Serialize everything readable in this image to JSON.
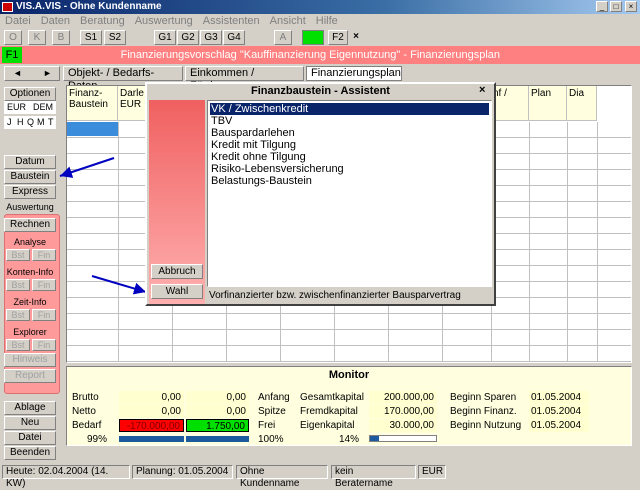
{
  "window": {
    "title": "VIS.A.VIS - Ohne Kundenname"
  },
  "menu": [
    "Datei",
    "Daten",
    "Beratung",
    "Auswertung",
    "Assistenten",
    "Ansicht",
    "Hilfe"
  ],
  "toolbar": {
    "buttons": [
      "O",
      "K",
      "B",
      "S1",
      "S2",
      "G1",
      "G2",
      "G3",
      "G4",
      "A",
      "F1",
      "F2"
    ],
    "close_label": "×"
  },
  "header": {
    "badge": "F1",
    "title": "Finanzierungsvorschlag \"Kauffinanzierung Eigennutzung\" - Finanzierungsplan"
  },
  "tabs": [
    "Objekt- / Bedarfs-Daten",
    "Einkommen / Förderung",
    "Finanzierungsplan"
  ],
  "nav_arrows": {
    "left": "◄",
    "right": "►"
  },
  "sidebar": {
    "optionen": "Optionen",
    "currency": [
      "EUR",
      "DEM"
    ],
    "periods": [
      "J",
      "H",
      "Q",
      "M",
      "T"
    ],
    "datum": "Datum",
    "baustein": "Baustein",
    "express": "Express",
    "auswertung": "Auswertung",
    "rechnen": "Rechnen",
    "analyse": "Analyse",
    "konten_info": "Konten-Info",
    "zeit_info": "Zeit-Info",
    "explorer": "Explorer",
    "bst": "Bst",
    "fin": "Fin",
    "hinweis": "Hinweis",
    "report": "Report",
    "ablage": "Ablage",
    "neu": "Neu",
    "datei": "Datei",
    "beenden": "Beenden"
  },
  "grid": {
    "col1": "Finanz-\nBaustein",
    "col2": "Darle\nEUR",
    "col_rent": "nf /",
    "col_plan": "Plan",
    "col_dia": "Dia"
  },
  "dialog": {
    "title": "Finanzbaustein - Assistent",
    "close": "×",
    "items": [
      "VK / Zwischenkredit",
      "TBV",
      "Bauspardarlehen",
      "Kredit mit Tilgung",
      "Kredit ohne Tilgung",
      "Risiko-Lebensversicherung",
      "Belastungs-Baustein"
    ],
    "selected_index": 0,
    "abbruch": "Abbruch",
    "wahl": "Wahl",
    "description": "Vorfinanzierter bzw. zwischenfinanzierter Bausparvertrag"
  },
  "monitor": {
    "title": "Monitor",
    "brutto_label": "Brutto",
    "brutto_1": "0,00",
    "brutto_2": "0,00",
    "netto_label": "Netto",
    "netto_1": "0,00",
    "netto_2": "0,00",
    "bedarf_label": "Bedarf",
    "bedarf_1": "-170.000,00",
    "bedarf_2": "1.750,00",
    "pct1": "99%",
    "anfang": "Anfang",
    "spitze": "Spitze",
    "frei": "Frei",
    "pct_frei": "100%",
    "gesamt_label": "Gesamtkapital",
    "gesamt_val": "200.000,00",
    "fremd_label": "Fremdkapital",
    "fremd_val": "170.000,00",
    "eigen_label": "Eigenkapital",
    "eigen_val": "30.000,00",
    "pct_eigen": "14%",
    "eigen_bar_fraction": 0.14,
    "bs_label": "Beginn Sparen",
    "bs_val": "01.05.2004",
    "bf_label": "Beginn Finanz.",
    "bf_val": "01.05.2004",
    "bn_label": "Beginn Nutzung",
    "bn_val": "01.05.2004"
  },
  "status": [
    "Heute: 02.04.2004 (14. KW)",
    "Planung: 01.05.2004",
    "Ohne Kundenname",
    "kein Beratername",
    "EUR"
  ],
  "colors": {
    "accent_pink": "#ff8080",
    "green": "#00e000",
    "selection": "#0a246a",
    "bedarf_red": "#ff0000"
  }
}
